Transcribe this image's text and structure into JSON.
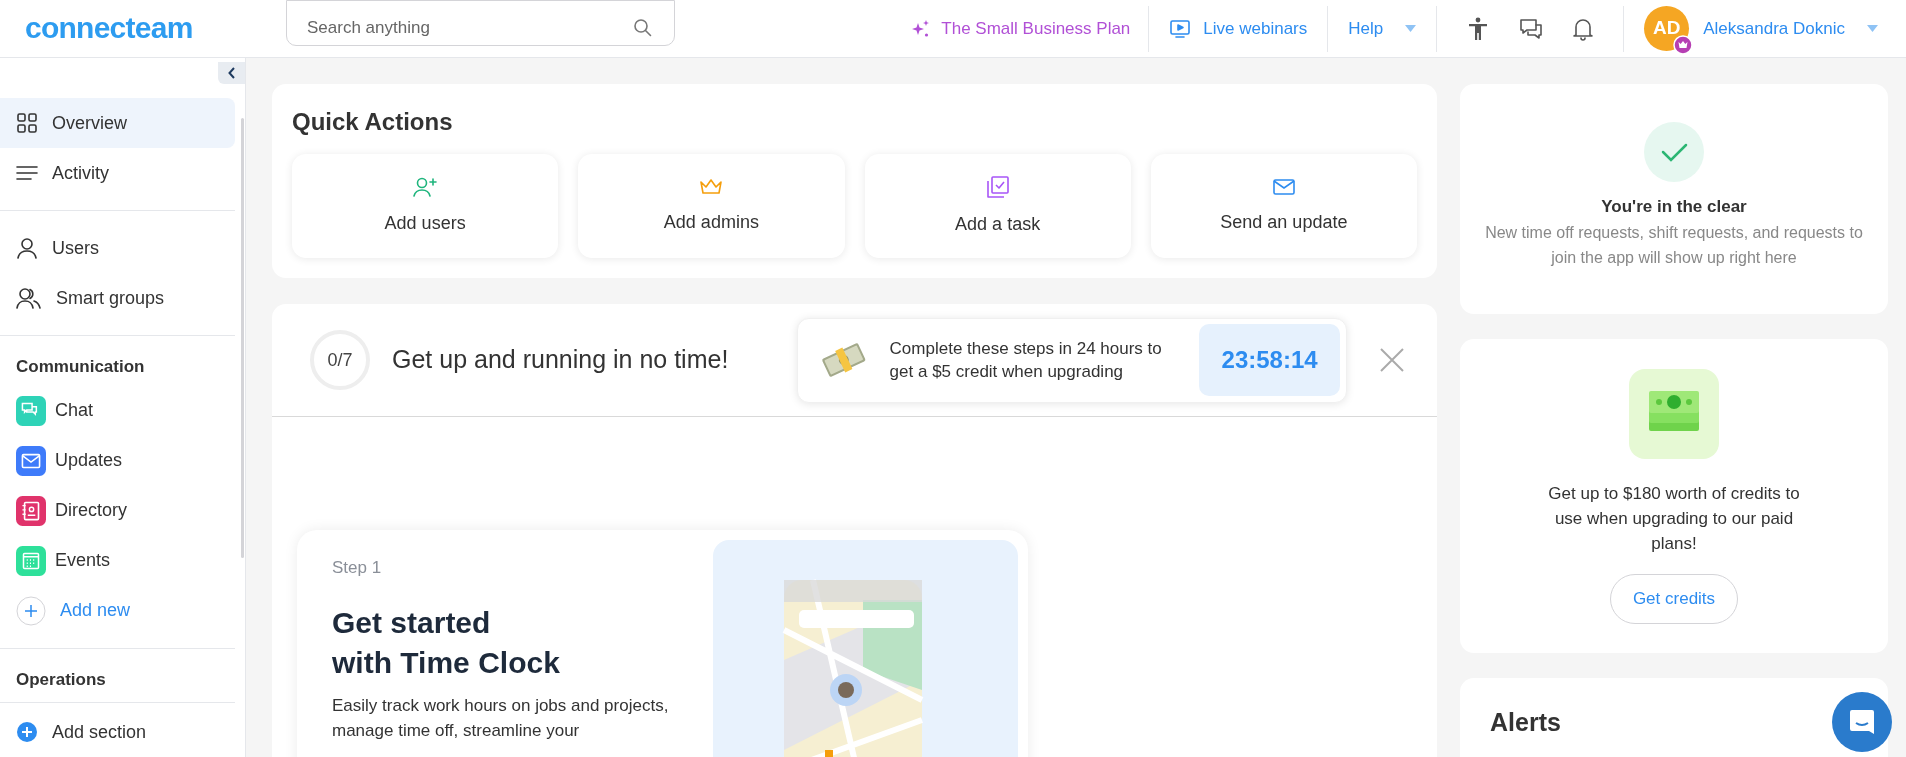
{
  "header": {
    "logo": "connecteam",
    "search": {
      "placeholder": "Search anything"
    },
    "plan_link": "The Small Business Plan",
    "webinars_link": "Live webinars",
    "help": "Help",
    "user": {
      "initials": "AD",
      "name": "Aleksandra Doknic"
    }
  },
  "sidebar": {
    "groups": [
      {
        "items": [
          {
            "label": "Overview",
            "selected": true
          },
          {
            "label": "Activity",
            "selected": false
          }
        ]
      },
      {
        "items": [
          {
            "label": "Users",
            "selected": false
          },
          {
            "label": "Smart groups",
            "selected": false
          }
        ]
      },
      {
        "heading": "Communication",
        "items": [
          {
            "label": "Chat",
            "kind": "app",
            "color": "#2ed3b7",
            "selected": false
          },
          {
            "label": "Updates",
            "kind": "app",
            "color": "#3e7bfa",
            "selected": false
          },
          {
            "label": "Directory",
            "kind": "app",
            "color": "#e0336b",
            "selected": false
          },
          {
            "label": "Events",
            "kind": "app",
            "color": "#2ee09a",
            "selected": false
          },
          {
            "label": "Add new",
            "kind": "add",
            "selected": false
          }
        ]
      },
      {
        "heading": "Operations",
        "items": [
          {
            "label": "Add section",
            "kind": "add-filled",
            "selected": false
          }
        ]
      }
    ]
  },
  "quick_actions": {
    "title": "Quick Actions",
    "actions": [
      "Add users",
      "Add admins",
      "Add a task",
      "Send an update"
    ]
  },
  "onboarding": {
    "progress": "0/7",
    "title": "Get up and running in no time!",
    "promo": "Complete these steps in 24 hours to get a $5 credit when upgrading",
    "timer": "23:58:14",
    "step": {
      "label": "Step 1",
      "title_lines": [
        "Get started",
        "with Time Clock"
      ],
      "description": "Easily track work hours on jobs and projects, manage time off, streamline your"
    }
  },
  "requests_card": {
    "title": "You're in the clear",
    "text": "New time off requests, shift requests, and requests to join the app will show up right here"
  },
  "credits_card": {
    "text": "Get up to $180 worth of credits to use when upgrading to our paid plans!",
    "button": "Get credits"
  },
  "alerts_card": {
    "title": "Alerts"
  }
}
